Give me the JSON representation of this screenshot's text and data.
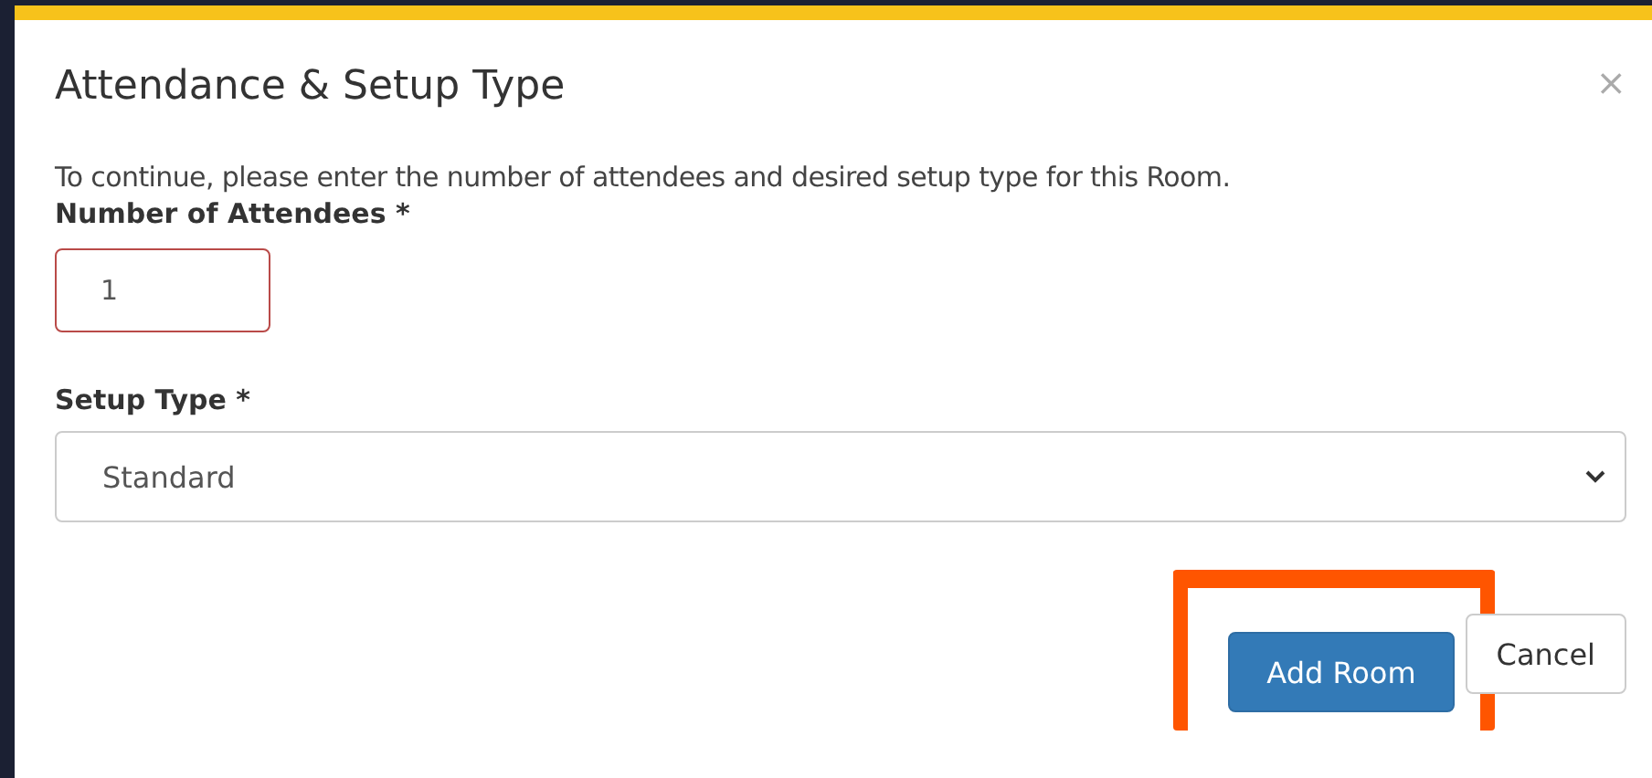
{
  "dialog": {
    "title": "Attendance & Setup Type",
    "close": "×",
    "intro": "To continue, please enter the number of attendees and desired setup type for this Room.",
    "fields": [
      {
        "kind": "number",
        "label": "Number of Attendees *",
        "value": "1",
        "invalid": true
      },
      {
        "kind": "select",
        "label": "Setup Type *",
        "value": "Standard",
        "invalid": false
      }
    ],
    "buttons": [
      {
        "label": "Add Room",
        "primary": true,
        "highlighted": true
      },
      {
        "label": "Cancel",
        "primary": false,
        "highlighted": false
      }
    ]
  }
}
